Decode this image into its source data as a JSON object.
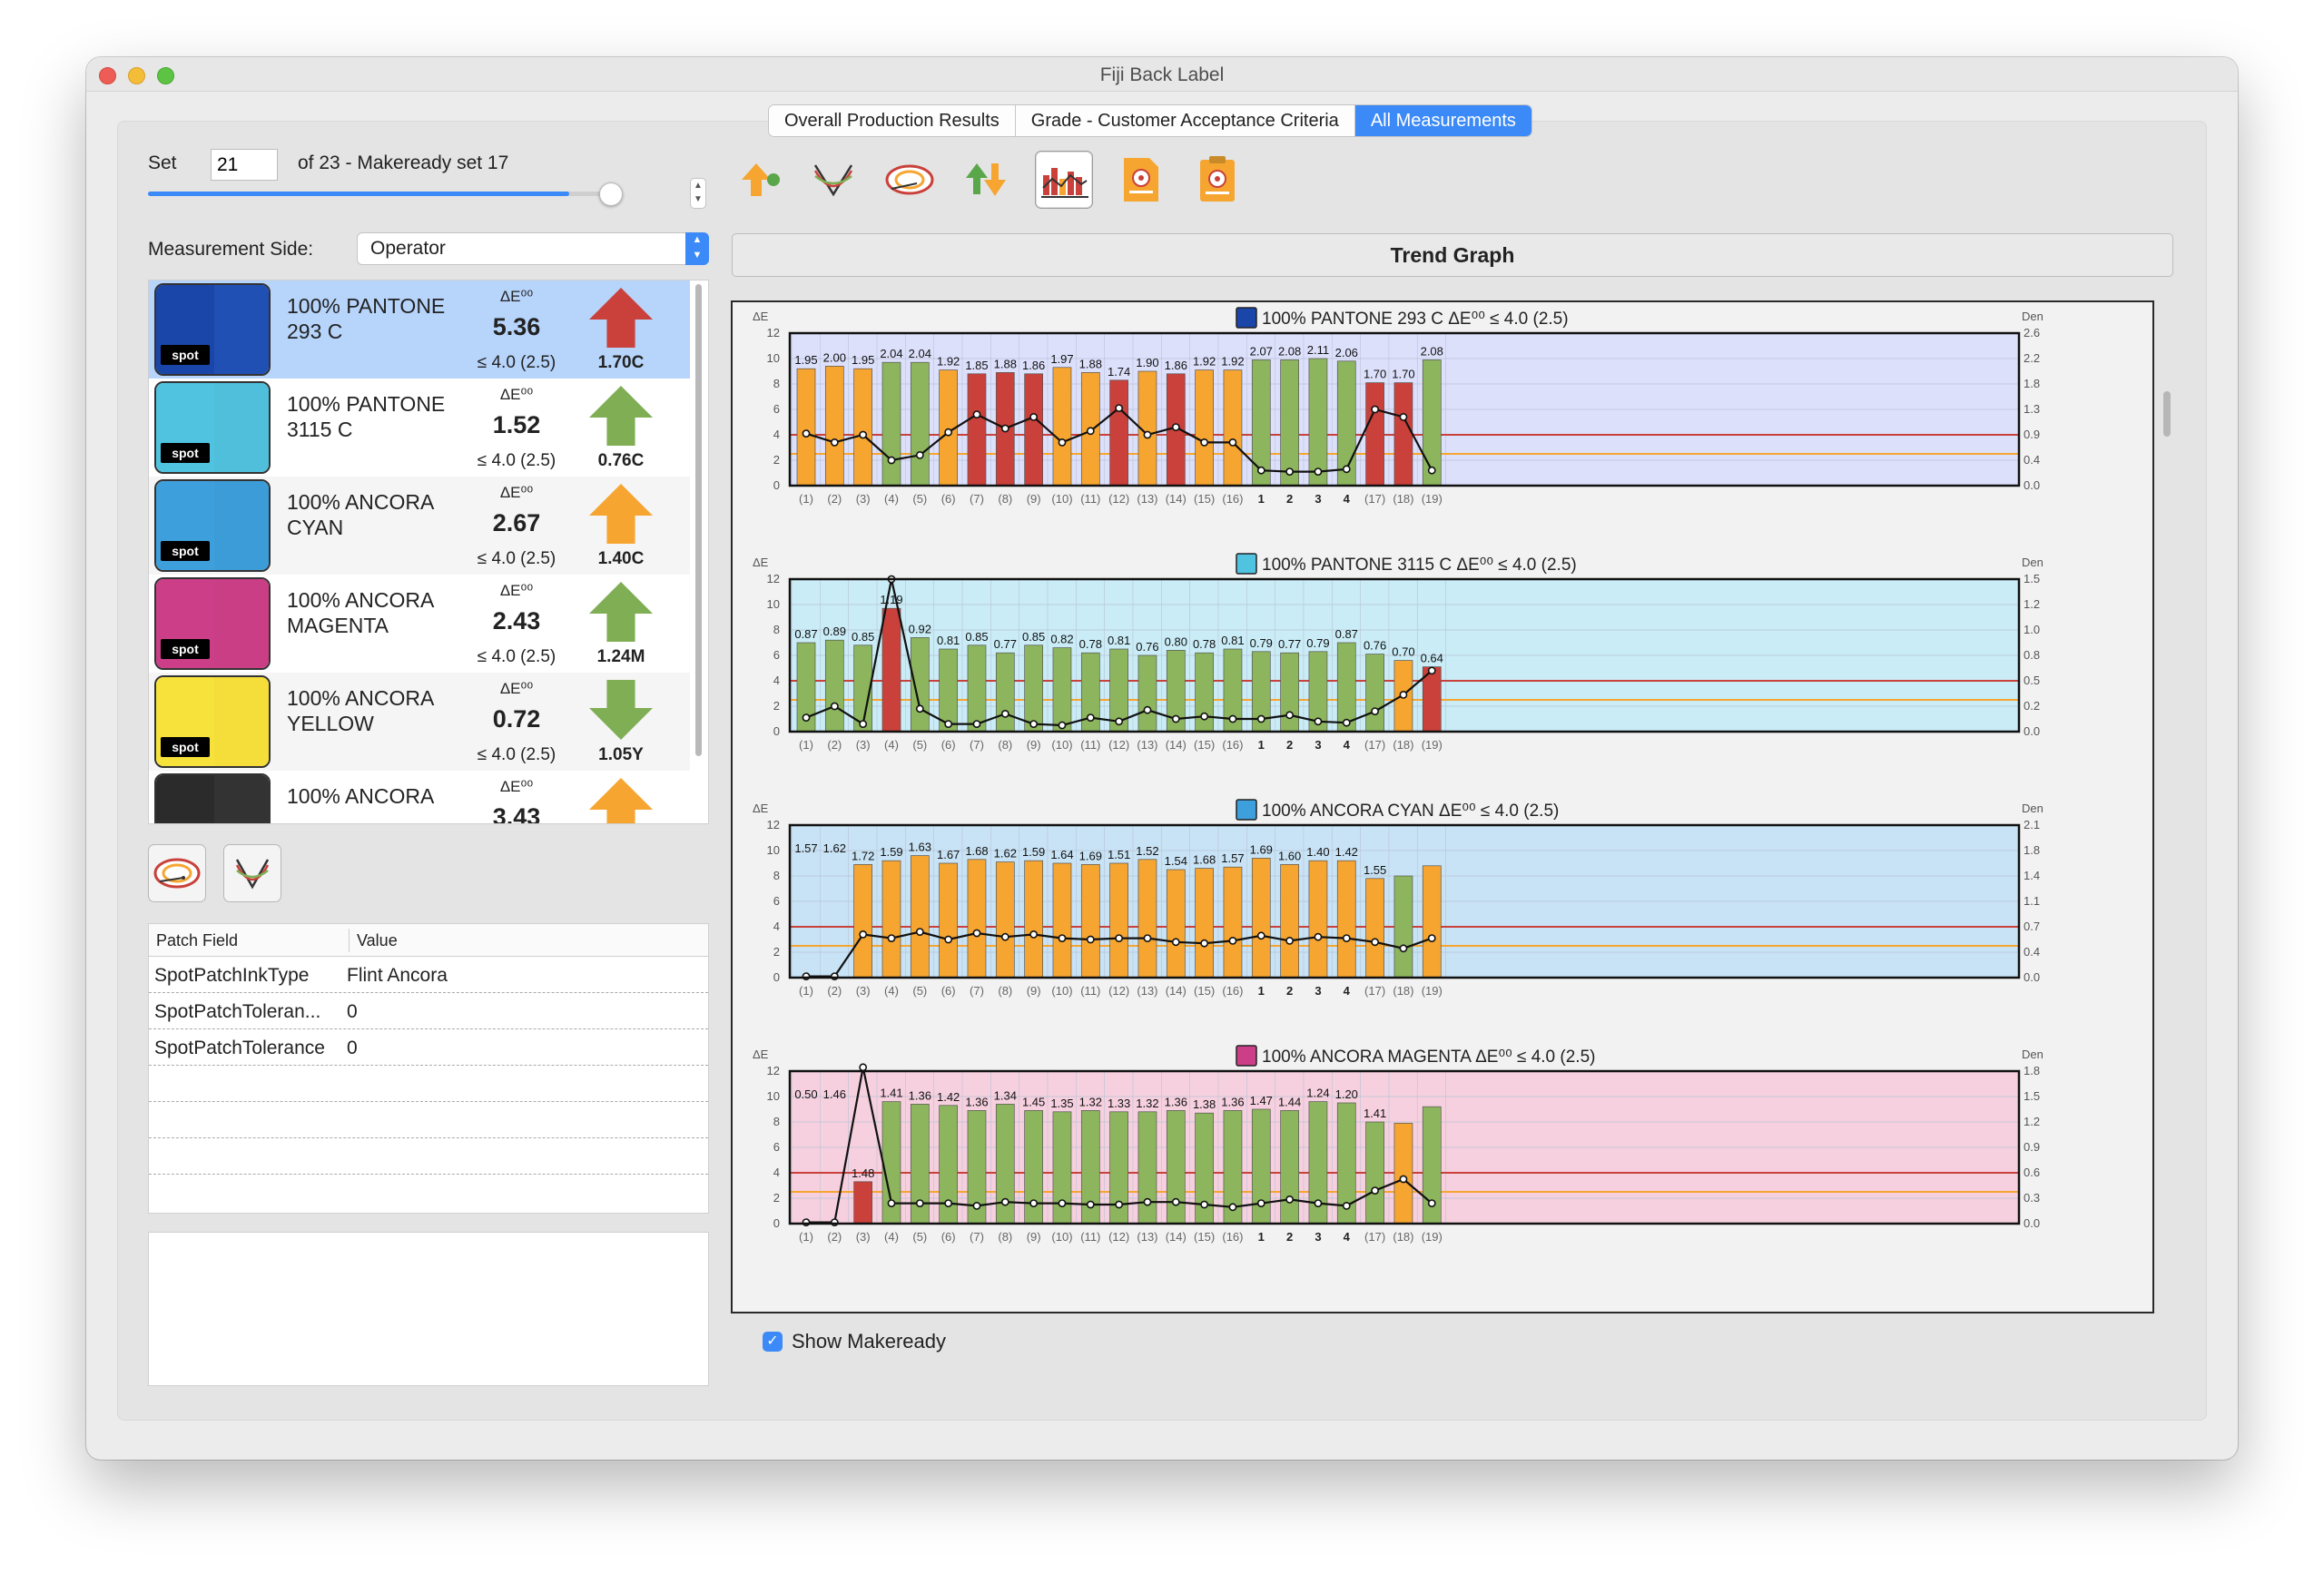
{
  "window": {
    "title": "Fiji Back Label"
  },
  "tabs": [
    {
      "label": "Overall Production Results",
      "active": false
    },
    {
      "label": "Grade - Customer Acceptance Criteria",
      "active": false
    },
    {
      "label": "All Measurements",
      "active": true
    }
  ],
  "set": {
    "label": "Set",
    "value": "21",
    "of_text": "of 23  - Makeready set 17",
    "slider_fraction": 0.91
  },
  "measurement_side": {
    "label": "Measurement Side:",
    "value": "Operator"
  },
  "colors": {
    "accent": "#3b8af7",
    "bar_green": "#8db55e",
    "bar_orange": "#f6a531",
    "bar_red": "#c9413a"
  },
  "ink_list": [
    {
      "name": "100% PANTONE 293 C",
      "de_header": "ΔE⁰⁰",
      "de": "5.36",
      "tol": "≤ 4.0 (2.5)",
      "arrow_dir": "up",
      "arrow_color": "#c9413a",
      "arrow_label": "1.70C",
      "swatch": "#1946a8",
      "swatch2": "#2150b5",
      "spot": "spot",
      "selected": true
    },
    {
      "name": "100% PANTONE 3115 C",
      "de_header": "ΔE⁰⁰",
      "de": "1.52",
      "tol": "≤ 4.0 (2.5)",
      "arrow_dir": "up",
      "arrow_color": "#7fae55",
      "arrow_label": "0.76C",
      "swatch": "#4fc3e0",
      "swatch2": "#50bfdc",
      "spot": "spot",
      "selected": false
    },
    {
      "name": "100% ANCORA CYAN",
      "de_header": "ΔE⁰⁰",
      "de": "2.67",
      "tol": "≤ 4.0 (2.5)",
      "arrow_dir": "up",
      "arrow_color": "#f6a531",
      "arrow_label": "1.40C",
      "swatch": "#3d9fdb",
      "swatch2": "#3b9cd8",
      "spot": "spot",
      "selected": false
    },
    {
      "name": "100% ANCORA MAGENTA",
      "de_header": "ΔE⁰⁰",
      "de": "2.43",
      "tol": "≤ 4.0 (2.5)",
      "arrow_dir": "up",
      "arrow_color": "#7fae55",
      "arrow_label": "1.24M",
      "swatch": "#cc3f88",
      "swatch2": "#c93e85",
      "spot": "spot",
      "selected": false
    },
    {
      "name": "100% ANCORA YELLOW",
      "de_header": "ΔE⁰⁰",
      "de": "0.72",
      "tol": "≤ 4.0 (2.5)",
      "arrow_dir": "down",
      "arrow_color": "#7fae55",
      "arrow_label": "1.05Y",
      "swatch": "#f7e23c",
      "swatch2": "#f5de3a",
      "spot": "spot",
      "selected": false
    },
    {
      "name": "100% ANCORA",
      "de_header": "ΔE⁰⁰",
      "de": "3.43",
      "tol": "",
      "arrow_dir": "up",
      "arrow_color": "#f6a531",
      "arrow_label": "",
      "swatch": "#2b2b2b",
      "swatch2": "#333333",
      "spot": "",
      "selected": false
    }
  ],
  "patch_table": {
    "col1": "Patch Field",
    "col2": "Value",
    "rows": [
      {
        "field": "SpotPatchInkType",
        "value": "Flint Ancora"
      },
      {
        "field": "SpotPatchToleran...",
        "value": "0"
      },
      {
        "field": "SpotPatchTolerance",
        "value": "0"
      }
    ]
  },
  "trend": {
    "title": "Trend Graph",
    "show_makeready_label": "Show Makeready",
    "show_makeready_checked": true
  },
  "chart_data": [
    {
      "type": "bar",
      "title": "100% PANTONE 293 C ΔE⁰⁰ ≤ 4.0 (2.5)",
      "title_color": "#1946a8",
      "bg": "#dde0fb",
      "ylabel": "ΔE",
      "y2label": "Den",
      "ylim": [
        0,
        12
      ],
      "yticks": [
        "0",
        "2",
        "4",
        "6",
        "8",
        "10",
        "12"
      ],
      "y2ticks": [
        "0.0",
        "0.4",
        "0.9",
        "1.3",
        "1.8",
        "2.2",
        "2.6"
      ],
      "categories": [
        "(1)",
        "(2)",
        "(3)",
        "(4)",
        "(5)",
        "(6)",
        "(7)",
        "(8)",
        "(9)",
        "(10)",
        "(11)",
        "(12)",
        "(13)",
        "(14)",
        "(15)",
        "(16)",
        "1",
        "2",
        "3",
        "4",
        "(17)",
        "(18)",
        "(19)"
      ],
      "bars": [
        9.2,
        9.4,
        9.2,
        9.7,
        9.7,
        9.1,
        8.8,
        8.9,
        8.8,
        9.3,
        8.9,
        8.3,
        9.0,
        8.8,
        9.1,
        9.1,
        9.9,
        9.9,
        10.0,
        9.8,
        8.1,
        8.1,
        9.9
      ],
      "bar_colors": [
        "o",
        "o",
        "o",
        "g",
        "g",
        "o",
        "r",
        "r",
        "r",
        "o",
        "o",
        "r",
        "o",
        "r",
        "o",
        "o",
        "g",
        "g",
        "g",
        "g",
        "r",
        "r",
        "g"
      ],
      "labels": [
        "1.95",
        "2.00",
        "1.95",
        "2.04",
        "2.04",
        "1.92",
        "1.85",
        "1.88",
        "1.86",
        "1.97",
        "1.88",
        "1.74",
        "1.90",
        "1.86",
        "1.92",
        "1.92",
        "2.07",
        "2.08",
        "2.11",
        "2.06",
        "1.70",
        "1.70",
        "2.08"
      ],
      "line": [
        4.1,
        3.4,
        4.0,
        2.0,
        2.4,
        4.2,
        5.6,
        4.5,
        5.4,
        3.4,
        4.3,
        6.1,
        4.0,
        4.6,
        3.4,
        3.4,
        1.2,
        1.1,
        1.1,
        1.3,
        6.0,
        5.4,
        1.2
      ],
      "red_line": 4.0,
      "orange_line": 2.5
    },
    {
      "type": "bar",
      "title": "100% PANTONE 3115 C ΔE⁰⁰ ≤ 4.0 (2.5)",
      "title_color": "#4fc3e0",
      "bg": "#c9ecf6",
      "ylabel": "ΔE",
      "y2label": "Den",
      "ylim": [
        0,
        12
      ],
      "yticks": [
        "0",
        "2",
        "4",
        "6",
        "8",
        "10",
        "12"
      ],
      "y2ticks": [
        "0.0",
        "0.2",
        "0.5",
        "0.8",
        "1.0",
        "1.2",
        "1.5"
      ],
      "categories": [
        "(1)",
        "(2)",
        "(3)",
        "(4)",
        "(5)",
        "(6)",
        "(7)",
        "(8)",
        "(9)",
        "(10)",
        "(11)",
        "(12)",
        "(13)",
        "(14)",
        "(15)",
        "(16)",
        "1",
        "2",
        "3",
        "4",
        "(17)",
        "(18)",
        "(19)"
      ],
      "bars": [
        7.0,
        7.2,
        6.8,
        9.7,
        7.4,
        6.5,
        6.8,
        6.2,
        6.8,
        6.6,
        6.2,
        6.5,
        6.0,
        6.4,
        6.2,
        6.5,
        6.3,
        6.2,
        6.3,
        7.0,
        6.1,
        5.6,
        5.1
      ],
      "bar_colors": [
        "g",
        "g",
        "g",
        "r",
        "g",
        "g",
        "g",
        "g",
        "g",
        "g",
        "g",
        "g",
        "g",
        "g",
        "g",
        "g",
        "g",
        "g",
        "g",
        "g",
        "g",
        "o",
        "r"
      ],
      "labels": [
        "0.87",
        "0.89",
        "0.85",
        "1.19",
        "0.92",
        "0.81",
        "0.85",
        "0.77",
        "0.85",
        "0.82",
        "0.78",
        "0.81",
        "0.76",
        "0.80",
        "0.78",
        "0.81",
        "0.79",
        "0.77",
        "0.79",
        "0.87",
        "0.76",
        "0.70",
        "0.64"
      ],
      "line": [
        1.1,
        2.0,
        0.6,
        12.0,
        1.8,
        0.6,
        0.6,
        1.4,
        0.6,
        0.5,
        1.1,
        0.8,
        1.7,
        1.0,
        1.2,
        1.0,
        1.0,
        1.3,
        0.8,
        0.7,
        1.6,
        2.9,
        4.8
      ],
      "red_line": 4.0,
      "orange_line": 2.5
    },
    {
      "type": "bar",
      "title": "100% ANCORA CYAN ΔE⁰⁰ ≤ 4.0 (2.5)",
      "title_color": "#3d9fdb",
      "bg": "#c8e3f5",
      "ylabel": "ΔE",
      "y2label": "Den",
      "ylim": [
        0,
        12
      ],
      "yticks": [
        "0",
        "2",
        "4",
        "6",
        "8",
        "10",
        "12"
      ],
      "y2ticks": [
        "0.0",
        "0.4",
        "0.7",
        "1.1",
        "1.4",
        "1.8",
        "2.1"
      ],
      "categories": [
        "(1)",
        "(2)",
        "(3)",
        "(4)",
        "(5)",
        "(6)",
        "(7)",
        "(8)",
        "(9)",
        "(10)",
        "(11)",
        "(12)",
        "(13)",
        "(14)",
        "(15)",
        "(16)",
        "1",
        "2",
        "3",
        "4",
        "(17)",
        "(18)",
        "(19)"
      ],
      "bars": [
        0,
        0,
        8.9,
        9.2,
        9.6,
        9.0,
        9.3,
        9.1,
        9.2,
        9.0,
        8.9,
        9.0,
        9.3,
        8.5,
        8.6,
        8.7,
        9.4,
        8.9,
        9.2,
        9.2,
        7.8,
        8.0,
        8.8
      ],
      "bar_colors": [
        "g",
        "g",
        "o",
        "o",
        "o",
        "o",
        "o",
        "o",
        "o",
        "o",
        "o",
        "o",
        "o",
        "o",
        "o",
        "o",
        "o",
        "o",
        "o",
        "o",
        "o",
        "g",
        "o"
      ],
      "labels": [
        "1.57",
        "1.62",
        "1.72",
        "1.59",
        "1.63",
        "1.67",
        "1.68",
        "1.62",
        "1.59",
        "1.64",
        "1.69",
        "1.51",
        "1.52",
        "1.54",
        "1.68",
        "1.57",
        "1.69",
        "1.60",
        "1.40",
        "1.42",
        "1.55",
        "",
        ""
      ],
      "line": [
        0.1,
        0.1,
        3.4,
        3.1,
        3.6,
        3.0,
        3.5,
        3.2,
        3.4,
        3.1,
        3.0,
        3.1,
        3.1,
        2.8,
        2.7,
        2.9,
        3.3,
        2.9,
        3.2,
        3.1,
        2.8,
        2.3,
        3.1
      ],
      "red_line": 4.0,
      "orange_line": 2.5
    },
    {
      "type": "bar",
      "title": "100% ANCORA MAGENTA ΔE⁰⁰ ≤ 4.0 (2.5)",
      "title_color": "#cc3f88",
      "bg": "#f6d0de",
      "ylabel": "ΔE",
      "y2label": "Den",
      "ylim": [
        0,
        12
      ],
      "yticks": [
        "0",
        "2",
        "4",
        "6",
        "8",
        "10",
        "12"
      ],
      "y2ticks": [
        "0.0",
        "0.3",
        "0.6",
        "0.9",
        "1.2",
        "1.5",
        "1.8"
      ],
      "categories": [
        "(1)",
        "(2)",
        "(3)",
        "(4)",
        "(5)",
        "(6)",
        "(7)",
        "(8)",
        "(9)",
        "(10)",
        "(11)",
        "(12)",
        "(13)",
        "(14)",
        "(15)",
        "(16)",
        "1",
        "2",
        "3",
        "4",
        "(17)",
        "(18)",
        "(19)"
      ],
      "bars": [
        0,
        0,
        3.3,
        9.6,
        9.4,
        9.3,
        8.9,
        9.4,
        8.9,
        8.8,
        8.9,
        8.8,
        8.8,
        8.9,
        8.7,
        8.9,
        9.0,
        8.9,
        9.6,
        9.5,
        8.0,
        7.9,
        9.2
      ],
      "bar_colors": [
        "g",
        "g",
        "r",
        "g",
        "g",
        "g",
        "g",
        "g",
        "g",
        "g",
        "g",
        "g",
        "g",
        "g",
        "g",
        "g",
        "g",
        "g",
        "g",
        "g",
        "g",
        "o",
        "g"
      ],
      "labels": [
        "0.50",
        "1.46",
        "1.48",
        "1.41",
        "1.36",
        "1.42",
        "1.36",
        "1.34",
        "1.45",
        "1.35",
        "1.32",
        "1.33",
        "1.32",
        "1.36",
        "1.38",
        "1.36",
        "1.47",
        "1.44",
        "1.24",
        "1.20",
        "1.41",
        "",
        ""
      ],
      "line": [
        0.1,
        0.1,
        12.5,
        1.6,
        1.6,
        1.6,
        1.4,
        1.7,
        1.6,
        1.6,
        1.5,
        1.5,
        1.7,
        1.7,
        1.5,
        1.3,
        1.6,
        1.9,
        1.6,
        1.4,
        2.6,
        3.5,
        1.6
      ],
      "red_line": 4.0,
      "orange_line": 2.5
    }
  ]
}
